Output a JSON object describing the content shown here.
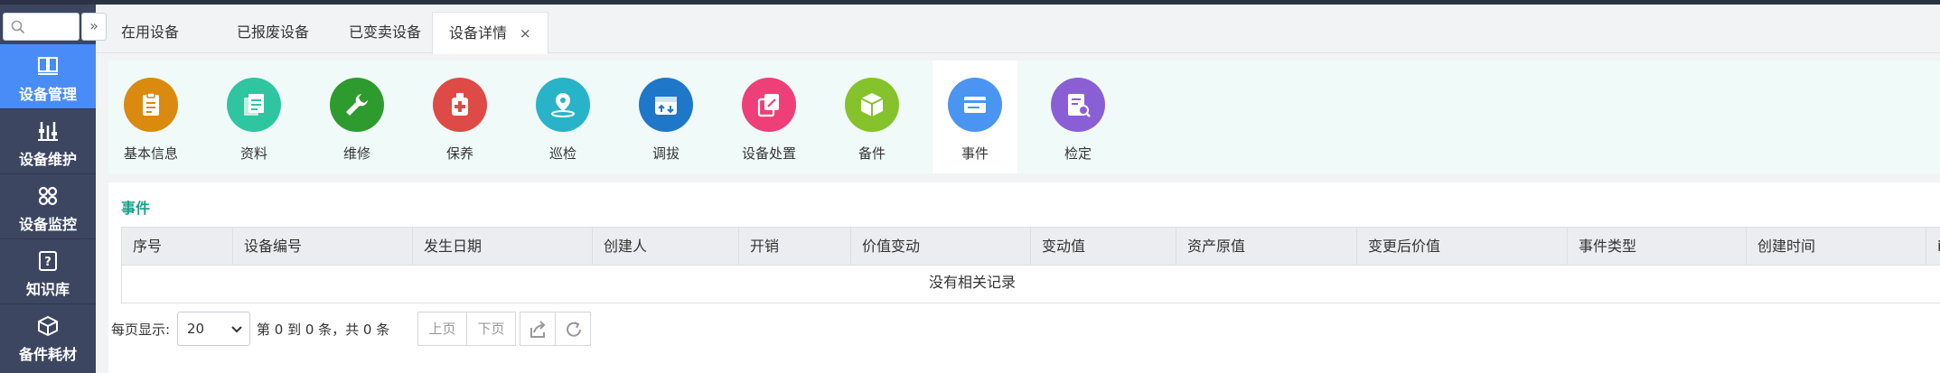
{
  "sidebar": {
    "collapse_icon": "»",
    "items": [
      {
        "label": "设备管理",
        "icon": "book-icon",
        "active": true
      },
      {
        "label": "设备维护",
        "icon": "tools-icon",
        "active": false
      },
      {
        "label": "设备监控",
        "icon": "monitor-icon",
        "active": false
      },
      {
        "label": "知识库",
        "icon": "question-icon",
        "active": false
      },
      {
        "label": "备件耗材",
        "icon": "cube-icon",
        "active": false
      }
    ]
  },
  "tabs": [
    {
      "label": "在用设备"
    },
    {
      "label": "已报废设备"
    },
    {
      "label": "已变卖设备"
    },
    {
      "label": "设备详情",
      "active": true,
      "close": "×"
    }
  ],
  "features": [
    {
      "label": "基本信息",
      "color": "#d98a0f"
    },
    {
      "label": "资料",
      "color": "#2ec5a0"
    },
    {
      "label": "维修",
      "color": "#2e9b2e"
    },
    {
      "label": "保养",
      "color": "#de4a45"
    },
    {
      "label": "巡检",
      "color": "#29b3c9"
    },
    {
      "label": "调拔",
      "color": "#1f77c9"
    },
    {
      "label": "设备处置",
      "color": "#ef3f78"
    },
    {
      "label": "备件",
      "color": "#86c22c"
    },
    {
      "label": "事件",
      "color": "#4a95f2",
      "active": true
    },
    {
      "label": "检定",
      "color": "#8a5fd6"
    }
  ],
  "section": {
    "title": "事件"
  },
  "table": {
    "columns": [
      "序号",
      "设备编号",
      "发生日期",
      "创建人",
      "开销",
      "价值变动",
      "变动值",
      "资产原值",
      "变更后价值",
      "事件类型",
      "创建时间",
      "i"
    ],
    "empty_text": "没有相关记录"
  },
  "pager": {
    "per_page_label": "每页显示:",
    "per_page_value": "20",
    "info": "第 0 到 0 条，共 0 条",
    "prev": "上页",
    "next": "下页"
  }
}
